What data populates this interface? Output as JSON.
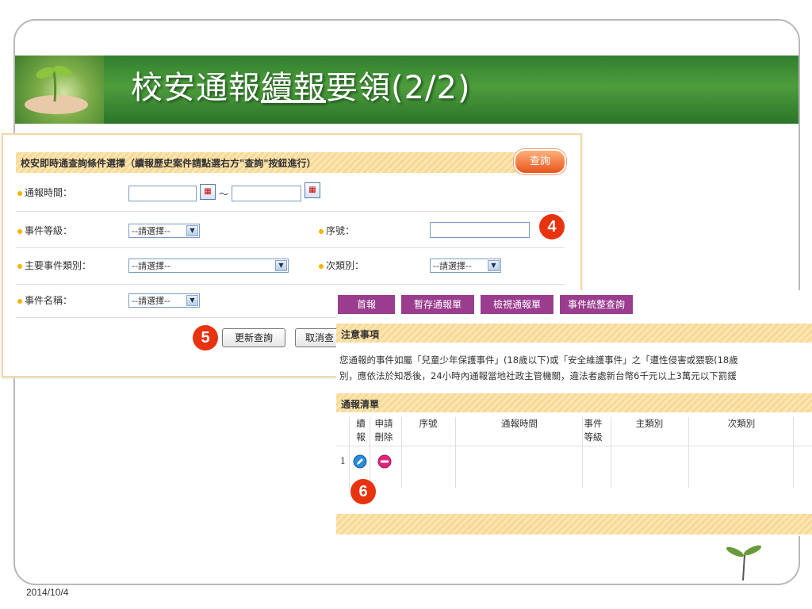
{
  "slide": {
    "title_pre": "校安通報",
    "title_underlined": "續報",
    "title_post": "要領(2/2)",
    "date": "2014/10/4"
  },
  "query_panel": {
    "header": "校安即時通查詢條件選擇（續報歷史案件請點選右方\"查詢\"按鈕進行）",
    "query_button": "查詢",
    "report_time_label": "通報時間：",
    "range_sep": "～",
    "event_level_label": "事件等級：",
    "serial_label": "序號：",
    "main_category_label": "主要事件類別：",
    "sub_category_label": "次類別：",
    "event_name_label": "事件名稱：",
    "select_placeholder": "--請選擇--",
    "update_button": "更新查詢",
    "cancel_button": "取消查"
  },
  "badges": {
    "b4": "4",
    "b5": "5",
    "b6": "6"
  },
  "results": {
    "nav": [
      "首報",
      "暫存通報單",
      "檢視通報單",
      "事件統整查詢"
    ],
    "notice_title": "注意事項",
    "notice_line1": "您通報的事件如屬「兒童少年保護事件」(18歲以下)或「安全維護事件」之「遭性侵害或猥褻(18歲",
    "notice_line2": "別，應依法於知悉後，24小時內通報當地社政主管機關，違法者處新台幣6千元以上3萬元以下罰鍰",
    "list_title": "通報清單",
    "columns": [
      "續報",
      "申請刪除",
      "序號",
      "通報時間",
      "事件等級",
      "主類別",
      "次類別"
    ],
    "rows": [
      {
        "index": "1"
      }
    ]
  },
  "icons": {
    "calendar": "calendar-icon",
    "edit": "edit-icon",
    "delete": "delete-icon"
  },
  "colors": {
    "banner": "#4e9d3c",
    "nav": "#9b3d8f",
    "badge": "#e8330f",
    "query_btn": "#e8551c"
  }
}
